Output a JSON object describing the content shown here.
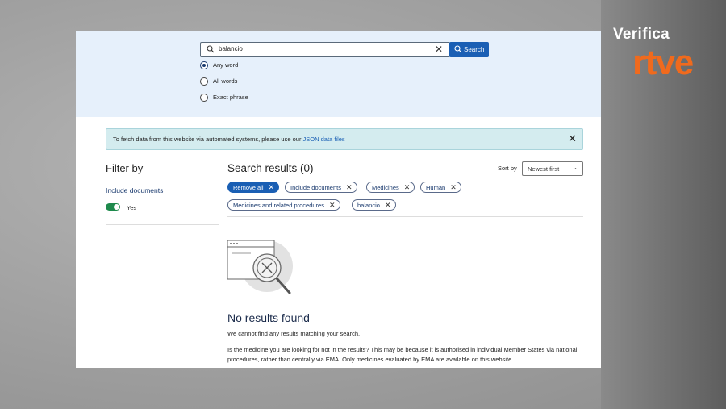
{
  "brand": {
    "verifica": "Verifica",
    "rtve": "rtve"
  },
  "search": {
    "query": "balancio",
    "button_label": "Search"
  },
  "match_options": [
    {
      "label": "Any word",
      "selected": true
    },
    {
      "label": "All words",
      "selected": false
    },
    {
      "label": "Exact phrase",
      "selected": false
    }
  ],
  "notice": {
    "text": "To fetch data from this website via automated systems, please use our ",
    "link": "JSON data files"
  },
  "filter": {
    "title": "Filter by",
    "include_documents": "Include documents",
    "toggle_label": "Yes",
    "toggle_on": true
  },
  "results": {
    "title": "Search results (0)",
    "sort_label": "Sort by",
    "sort_value": "Newest first",
    "chips": [
      "Remove all",
      "Include documents",
      "Medicines",
      "Human",
      "Medicines and related procedures",
      "balancio"
    ]
  },
  "no_results": {
    "title": "No results found",
    "line1": "We cannot find any results matching your search.",
    "line2": "Is the medicine you are looking for not in the results? This may be because it is authorised in individual Member States via national procedures, rather than centrally via EMA. Only medicines evaluated by EMA are available on this website."
  },
  "colors": {
    "accent": "#1a5fb4",
    "toggle": "#1e8a4c",
    "brand_orange": "#f06a1d",
    "band": "#e6f0fb",
    "notice": "#d4ecef"
  }
}
